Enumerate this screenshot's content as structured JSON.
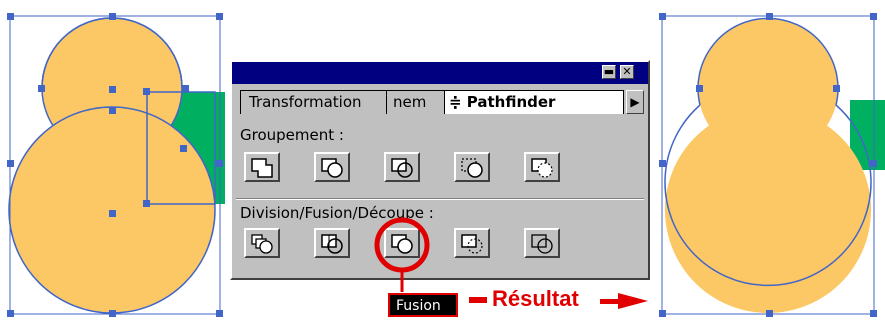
{
  "colors": {
    "shape_fill": "#fcc865",
    "shape_stroke": "#4266c8",
    "green_shape": "#00b060",
    "highlight": "#e00000",
    "panel_bg": "#c0c0c0",
    "titlebar": "#000080"
  },
  "panel": {
    "titlebar_buttons": [
      "minimize-icon",
      "close-icon"
    ],
    "tabs": [
      {
        "label": "Transformation"
      },
      {
        "label": "nem"
      },
      {
        "label": "≑ Pathfinder"
      }
    ],
    "tab_menu_icon": "triangle-right-icon",
    "groupement": {
      "label": "Groupement :",
      "buttons": [
        "unite-icon",
        "intersect-icon",
        "exclude-icon",
        "minus-front-icon",
        "minus-back-icon"
      ]
    },
    "division": {
      "label": "Division/Fusion/Découpe :",
      "buttons": [
        "divide-icon",
        "trim-icon",
        "merge-icon",
        "crop-icon",
        "outline-icon"
      ]
    }
  },
  "tooltip": {
    "label": "Fusion"
  },
  "annotation": {
    "label": "Résultat",
    "arrow_icon": "arrow-right-icon"
  }
}
